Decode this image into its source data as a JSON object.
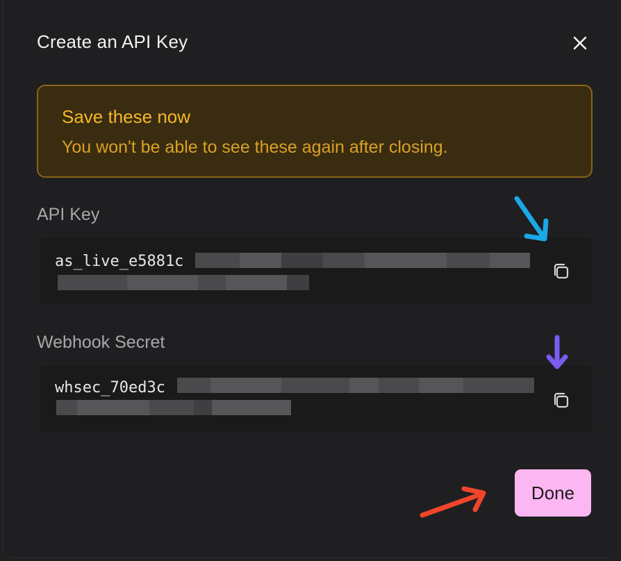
{
  "dialog": {
    "title": "Create an API Key",
    "close_icon": "close-icon"
  },
  "warning": {
    "title": "Save these now",
    "message": "You won't be able to see these again after closing."
  },
  "api_key": {
    "label": "API Key",
    "value": "as_live_e5881c",
    "copy_icon": "copy-icon"
  },
  "webhook_secret": {
    "label": "Webhook Secret",
    "value": "whsec_70ed3c",
    "copy_icon": "copy-icon"
  },
  "actions": {
    "done_label": "Done"
  },
  "colors": {
    "warning_text": "#f5b82a",
    "warning_bg": "#3a2c10",
    "warning_border": "#8a6416",
    "done_bg": "#fcb6f1",
    "annotation_blue": "#1aa8e6",
    "annotation_purple": "#7a5cf0",
    "annotation_red": "#f0452a"
  }
}
